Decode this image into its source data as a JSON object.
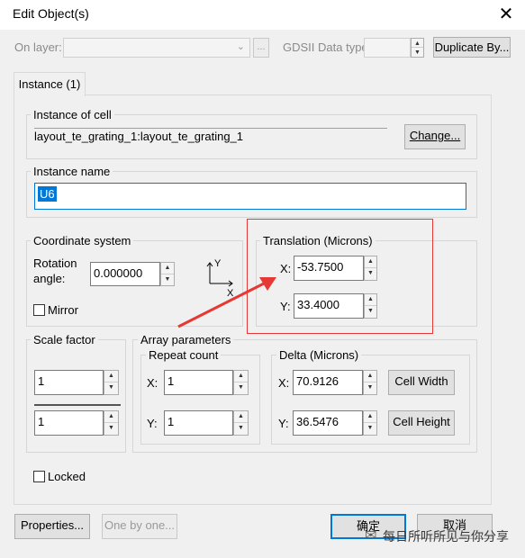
{
  "window": {
    "title": "Edit Object(s)",
    "close_glyph": "✕"
  },
  "top_row": {
    "on_layer_label": "On layer:",
    "ellipsis_label": "...",
    "gdsii_label": "GDSII Data type:",
    "duplicate_label": "Duplicate By..."
  },
  "tab": {
    "label": "Instance (1)"
  },
  "instance_of_cell": {
    "label": "Instance of cell",
    "value": "layout_te_grating_1:layout_te_grating_1",
    "change_label": "Change..."
  },
  "instance_name": {
    "label": "Instance name",
    "value": "U6"
  },
  "coordinate_system": {
    "label": "Coordinate system",
    "rotation_label_1": "Rotation",
    "rotation_label_2": "angle:",
    "rotation_value": "0.000000",
    "mirror_label": "Mirror",
    "axis_y": "Y",
    "axis_x": "X"
  },
  "translation": {
    "label": "Translation (Microns)",
    "x_label": "X:",
    "x_value": "-53.7500",
    "y_label": "Y:",
    "y_value": "33.4000"
  },
  "scale_factor": {
    "label": "Scale factor",
    "value1": "1",
    "value2": "1"
  },
  "array_parameters": {
    "label": "Array parameters",
    "repeat_count": {
      "label": "Repeat count",
      "x_label": "X:",
      "x_value": "1",
      "y_label": "Y:",
      "y_value": "1"
    },
    "delta": {
      "label": "Delta (Microns)",
      "x_label": "X:",
      "x_value": "70.9126",
      "y_label": "Y:",
      "y_value": "36.5476",
      "cell_width_label": "Cell Width",
      "cell_height_label": "Cell Height"
    }
  },
  "locked": {
    "label": "Locked"
  },
  "bottom": {
    "properties_label": "Properties...",
    "one_by_one_label": "One by one...",
    "ok_label": "确定",
    "cancel_label": "取消"
  },
  "watermark": "每日所听所见与你分享",
  "colors": {
    "annotation_red": "#e53935",
    "selection_blue": "#0078d7",
    "accent_blue": "#0078d7"
  }
}
